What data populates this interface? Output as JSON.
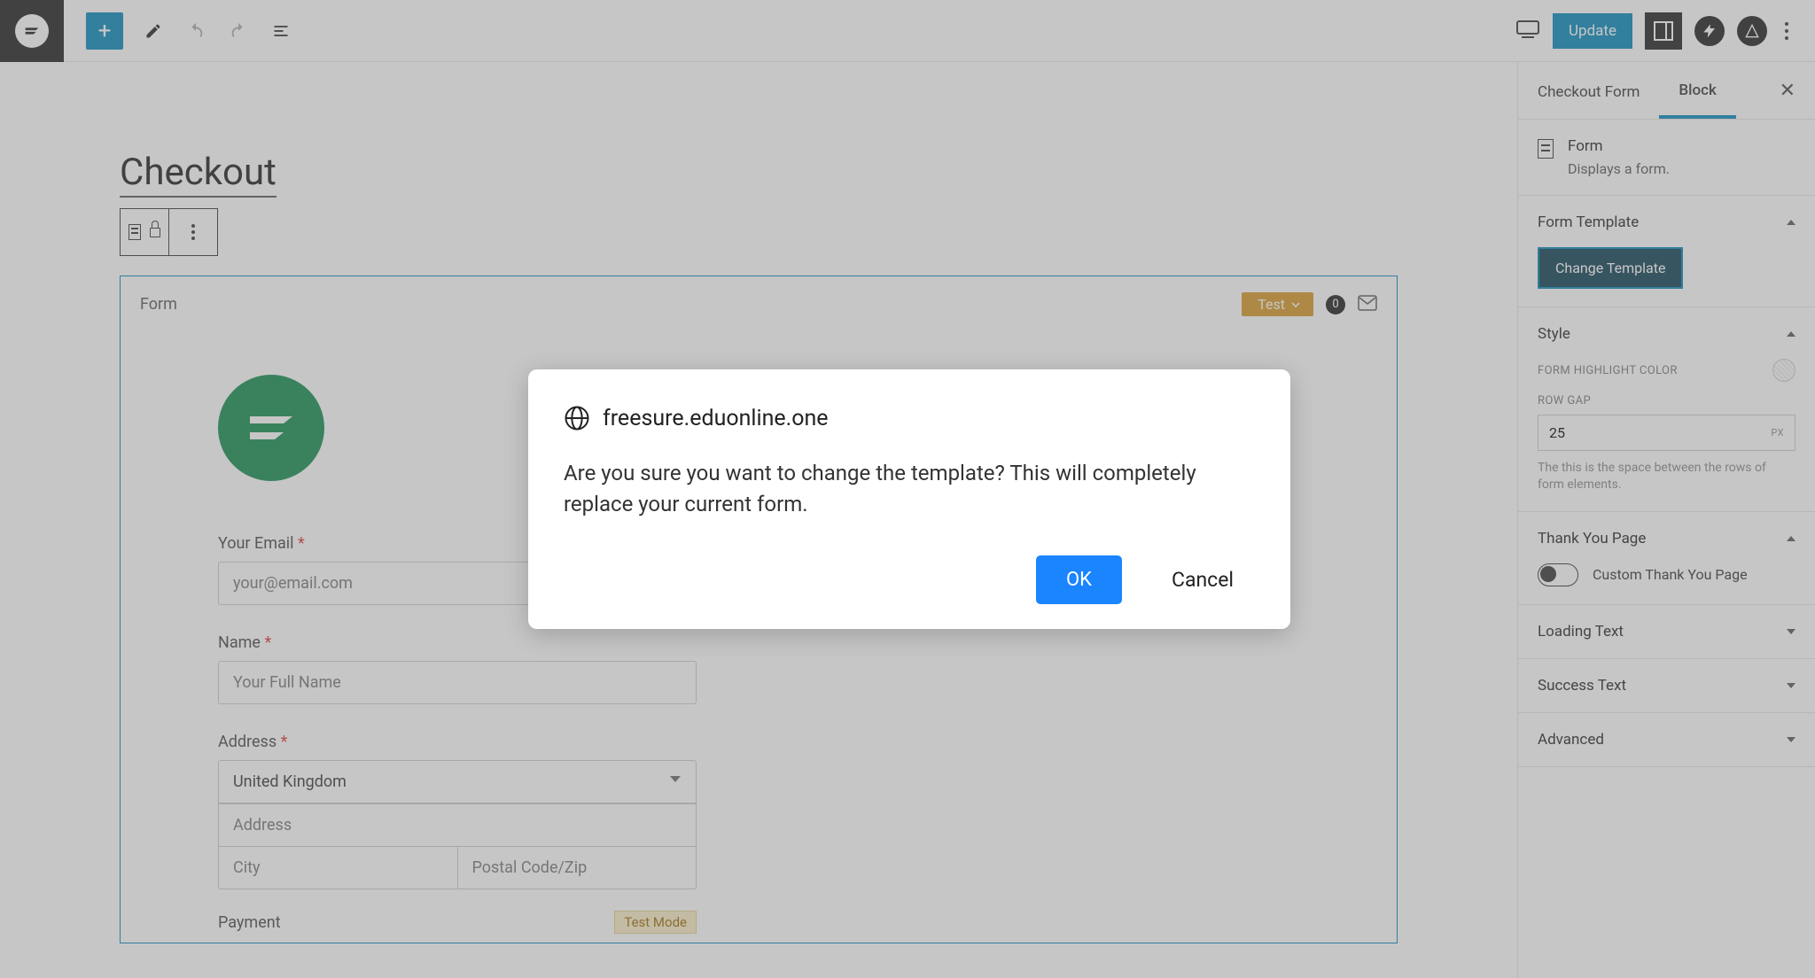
{
  "topbar": {
    "update_label": "Update"
  },
  "page": {
    "title": "Checkout"
  },
  "form_block": {
    "header_label": "Form",
    "test_pill": "Test",
    "count": "0",
    "logo_accent": "#0f8a4a",
    "email": {
      "label": "Your Email",
      "placeholder": "your@email.com"
    },
    "name": {
      "label": "Name",
      "placeholder": "Your Full Name"
    },
    "address": {
      "label": "Address",
      "country_selected": "United Kingdom",
      "line1_placeholder": "Address",
      "city_placeholder": "City",
      "zip_placeholder": "Postal Code/Zip"
    },
    "payment": {
      "label": "Payment",
      "test_mode": "Test Mode"
    }
  },
  "sidebar": {
    "tabs": [
      "Checkout Form",
      "Block"
    ],
    "block_info": {
      "title": "Form",
      "desc": "Displays a form."
    },
    "form_template": {
      "title": "Form Template",
      "button": "Change Template"
    },
    "style": {
      "title": "Style",
      "highlight_label": "FORM HIGHLIGHT COLOR",
      "row_gap_label": "ROW GAP",
      "row_gap_value": "25",
      "row_gap_unit": "PX",
      "row_gap_help": "The this is the space between the rows of form elements."
    },
    "thank_you": {
      "title": "Thank You Page",
      "toggle_label": "Custom Thank You Page"
    },
    "loading_text": "Loading Text",
    "success_text": "Success Text",
    "advanced": "Advanced"
  },
  "dialog": {
    "domain": "freesure.eduonline.one",
    "message": "Are you sure you want to change the template? This will completely replace your current form.",
    "ok": "OK",
    "cancel": "Cancel"
  }
}
